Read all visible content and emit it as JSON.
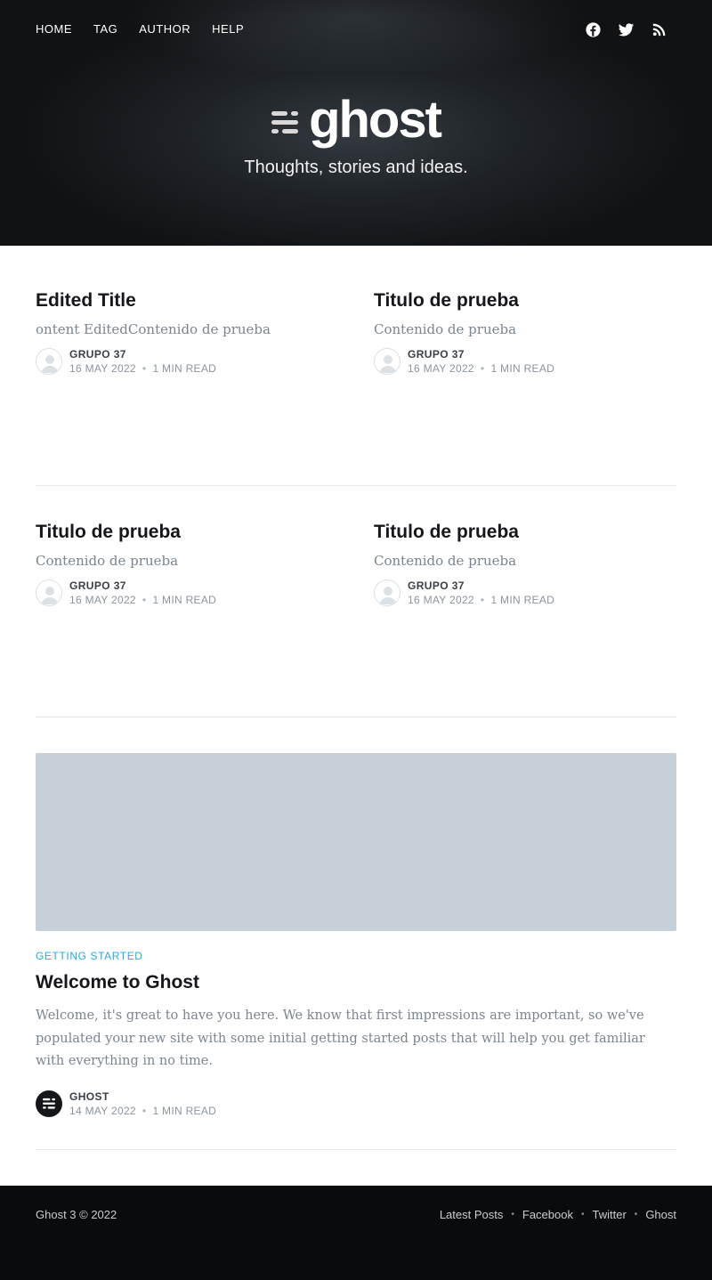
{
  "header": {
    "nav": [
      "HOME",
      "TAG",
      "AUTHOR",
      "HELP"
    ],
    "social_icons": [
      "facebook-icon",
      "twitter-icon",
      "rss-icon"
    ],
    "logo_text": "ghost",
    "tagline": "Thoughts, stories and ideas."
  },
  "posts": [
    {
      "title": "Edited Title",
      "excerpt": "ontent EditedContenido de prueba",
      "author": "GRUPO 37",
      "date": "16 MAY 2022",
      "read_time": "1 MIN READ"
    },
    {
      "title": "Titulo de prueba",
      "excerpt": "Contenido de prueba",
      "author": "GRUPO 37",
      "date": "16 MAY 2022",
      "read_time": "1 MIN READ"
    },
    {
      "title": "Titulo de prueba",
      "excerpt": "Contenido de prueba",
      "author": "GRUPO 37",
      "date": "16 MAY 2022",
      "read_time": "1 MIN READ"
    },
    {
      "title": "Titulo de prueba",
      "excerpt": "Contenido de prueba",
      "author": "GRUPO 37",
      "date": "16 MAY 2022",
      "read_time": "1 MIN READ"
    }
  ],
  "feature": {
    "tag": "GETTING STARTED",
    "title": "Welcome to Ghost",
    "excerpt": "Welcome, it's great to have you here. We know that first impressions are important, so we've populated your new site with some initial getting started posts that will help you get familiar with everything in no time.",
    "author": "GHOST",
    "date": "14 MAY 2022",
    "read_time": "1 MIN READ"
  },
  "footer": {
    "copyright": "Ghost 3 © 2022",
    "links": [
      "Latest Posts",
      "Facebook",
      "Twitter",
      "Ghost"
    ],
    "separator": "•"
  },
  "colors": {
    "header_bg": "#121416",
    "accent": "#26a8ed",
    "feature_image_placeholder": "#c5d0d9",
    "footer_bg": "#0a0b0c"
  }
}
